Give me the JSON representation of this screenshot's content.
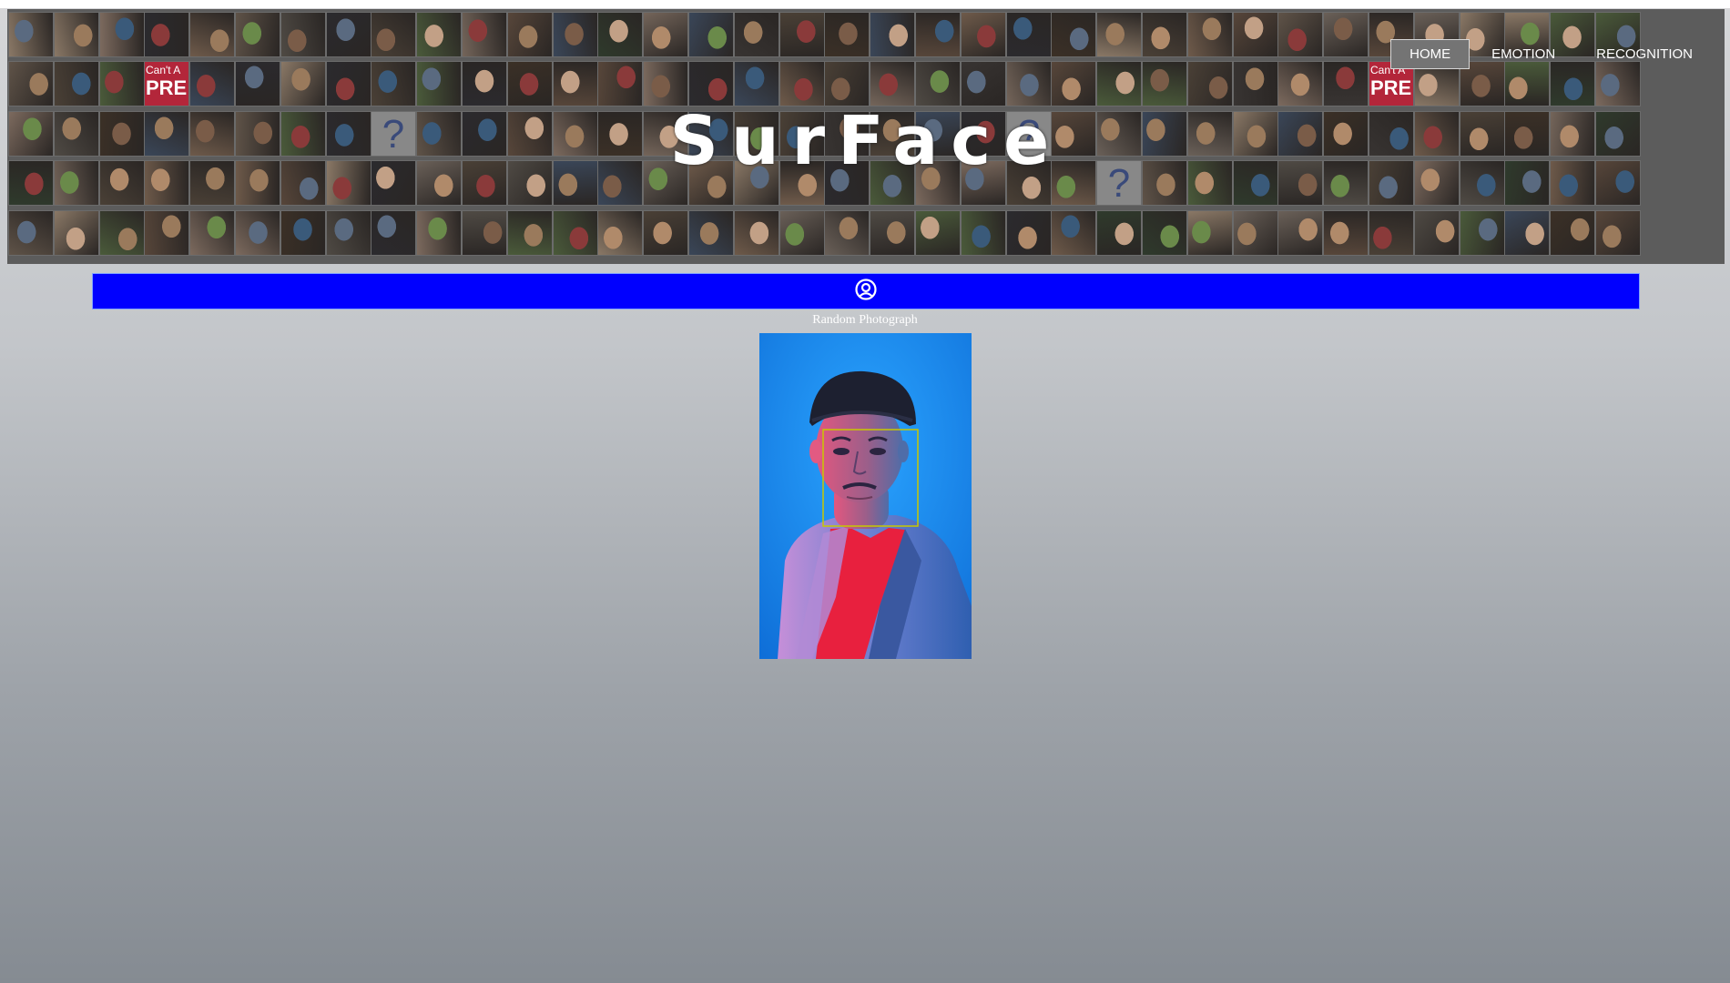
{
  "app": {
    "title": "SurFace"
  },
  "nav": {
    "items": [
      "HOME",
      "EMOTION",
      "RECOGNITION"
    ],
    "active_index": 0
  },
  "mosaic": {
    "sign_text_1": "Can't A",
    "sign_text_2": "PREM"
  },
  "toolbar": {
    "icon": "user-circle-icon"
  },
  "main": {
    "caption": "Random Photograph"
  },
  "colors": {
    "bar": "#0000ff",
    "face_box": "#c8c800",
    "photo_bg": "#1a8ff0"
  }
}
